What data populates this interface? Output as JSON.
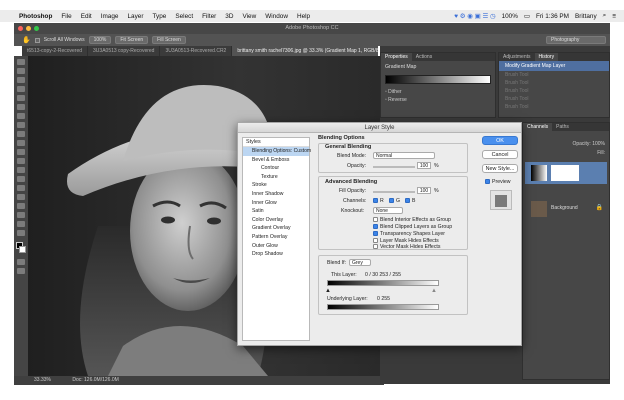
{
  "menubar": {
    "app": "Photoshop",
    "items": [
      "File",
      "Edit",
      "Image",
      "Layer",
      "Type",
      "Select",
      "Filter",
      "3D",
      "View",
      "Window",
      "Help"
    ],
    "battery": "100%",
    "clock": "Fri 1:36 PM",
    "user": "Brittany"
  },
  "window": {
    "title": "Adobe Photoshop CC"
  },
  "options_bar": {
    "scroll_all": "Scroll All Windows",
    "zoom": "100%",
    "fit_screen": "Fit Screen",
    "fill_screen": "Fill Screen",
    "workspace": "Photography"
  },
  "doc_tabs": [
    {
      "label": "t6513-copy-2-Recovered",
      "active": false
    },
    {
      "label": "3U3A0513 copy-Recovered",
      "active": false
    },
    {
      "label": "3U3A0513-Recovered.CR2",
      "active": false
    },
    {
      "label": "brittany smith rachel7306.jpg @ 33.3% (Gradient Map 1, RGB/8*)",
      "active": true
    }
  ],
  "status_bar": {
    "zoom": "33.33%",
    "doc": "Doc: 126.0M/126.0M"
  },
  "properties_panel": {
    "tabs": [
      "Properties",
      "Actions"
    ],
    "title": "Gradient Map",
    "dither": "Dither",
    "reverse": "Reverse"
  },
  "history_panel": {
    "tabs": [
      "Adjustments",
      "History"
    ],
    "items": [
      "Modify Gradient Map Layer",
      "Brush Tool",
      "Brush Tool",
      "Brush Tool",
      "Brush Tool",
      "Brush Tool"
    ]
  },
  "layers_panel": {
    "tabs": [
      "Channels",
      "Paths"
    ],
    "opacity_label": "Opacity:",
    "opacity": "100%",
    "fill_label": "Fill:",
    "background_label": "Background"
  },
  "layer_style": {
    "title": "Layer Style",
    "styles_header": "Styles",
    "styles": [
      {
        "label": "Blending Options: Custom",
        "sel": true,
        "indent": false
      },
      {
        "label": "Bevel & Emboss",
        "sel": false,
        "indent": false
      },
      {
        "label": "Contour",
        "sel": false,
        "indent": true
      },
      {
        "label": "Texture",
        "sel": false,
        "indent": true
      },
      {
        "label": "Stroke",
        "sel": false,
        "indent": false
      },
      {
        "label": "Inner Shadow",
        "sel": false,
        "indent": false
      },
      {
        "label": "Inner Glow",
        "sel": false,
        "indent": false
      },
      {
        "label": "Satin",
        "sel": false,
        "indent": false
      },
      {
        "label": "Color Overlay",
        "sel": false,
        "indent": false
      },
      {
        "label": "Gradient Overlay",
        "sel": false,
        "indent": false
      },
      {
        "label": "Pattern Overlay",
        "sel": false,
        "indent": false
      },
      {
        "label": "Outer Glow",
        "sel": false,
        "indent": false
      },
      {
        "label": "Drop Shadow",
        "sel": false,
        "indent": false
      }
    ],
    "blending_options": "Blending Options",
    "general_blending": "General Blending",
    "blend_mode_label": "Blend Mode:",
    "blend_mode": "Normal",
    "opacity_label": "Opacity:",
    "opacity": "100",
    "percent": "%",
    "advanced_blending": "Advanced Blending",
    "fill_opacity_label": "Fill Opacity:",
    "fill_opacity": "100",
    "channels_label": "Channels:",
    "channels": [
      "R",
      "G",
      "B"
    ],
    "knockout_label": "Knockout:",
    "knockout": "None",
    "checks": [
      {
        "label": "Blend Interior Effects as Group",
        "on": false
      },
      {
        "label": "Blend Clipped Layers as Group",
        "on": true
      },
      {
        "label": "Transparency Shapes Layer",
        "on": true
      },
      {
        "label": "Layer Mask Hides Effects",
        "on": false
      },
      {
        "label": "Vector Mask Hides Effects",
        "on": false
      }
    ],
    "blend_if_label": "Blend If:",
    "blend_if": "Grey",
    "this_layer_label": "This Layer:",
    "this_layer_values": "0 / 30    253 / 255",
    "underlying_label": "Underlying Layer:",
    "underlying_values": "0        255",
    "buttons": {
      "ok": "OK",
      "cancel": "Cancel",
      "new_style": "New Style...",
      "preview": "Preview"
    }
  }
}
